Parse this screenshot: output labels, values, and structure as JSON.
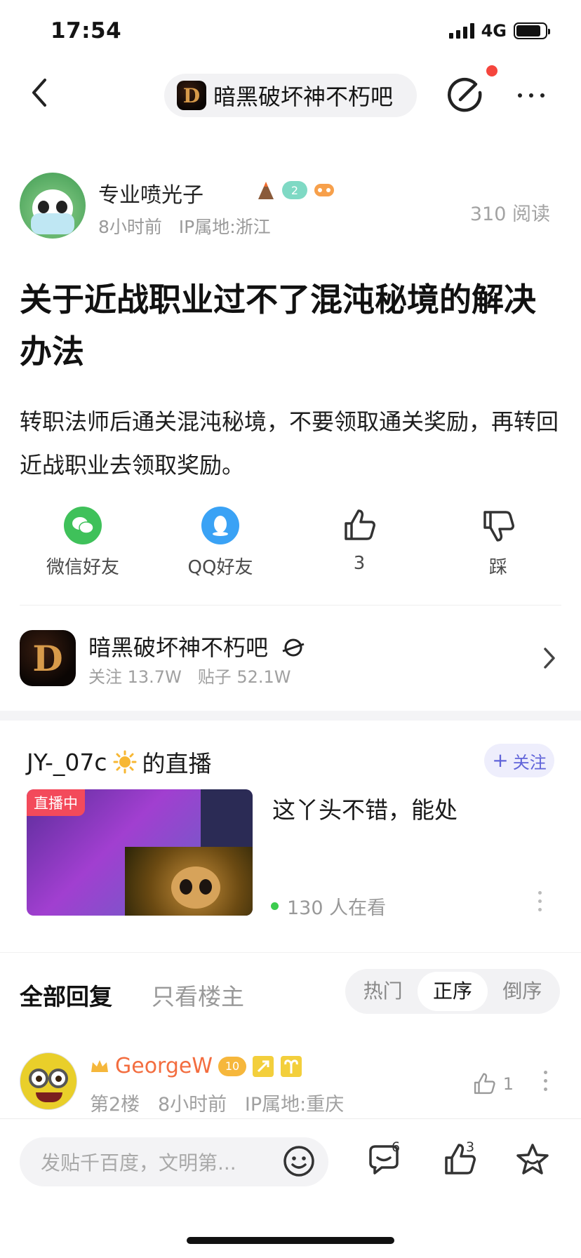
{
  "status_bar": {
    "time": "17:54",
    "network": "4G"
  },
  "nav": {
    "forum_title": "暗黑破坏神不朽吧",
    "logo_letter": "D"
  },
  "post": {
    "author": "专业喷光子",
    "level": "2",
    "time_ago": "8小时前",
    "ip": "IP属地:浙江",
    "views": "310 阅读",
    "title": "关于近战职业过不了混沌秘境的解决办法",
    "body": "转职法师后通关混沌秘境，不要领取通关奖励，再转回近战职业去领取奖励。"
  },
  "actions": {
    "wechat": "微信好友",
    "qq": "QQ好友",
    "like_count": "3",
    "dislike": "踩"
  },
  "forum_card": {
    "name": "暗黑破坏神不朽吧",
    "logo_letter": "D",
    "followers": "关注 13.7W",
    "posts": "贴子 52.1W"
  },
  "live": {
    "streamer": "JY-_07c",
    "suffix": "的直播",
    "follow": "关注",
    "badge": "直播中",
    "description": "这丫头不错，能处",
    "watching": "130 人在看"
  },
  "replies": {
    "tab_all": "全部回复",
    "tab_owner": "只看楼主",
    "sort": [
      {
        "label": "热门",
        "active": false
      },
      {
        "label": "正序",
        "active": true
      },
      {
        "label": "倒序",
        "active": false
      }
    ]
  },
  "comment": {
    "author": "GeorgeW",
    "level": "10",
    "floor": "第2楼",
    "time_ago": "8小时前",
    "ip": "IP属地:重庆",
    "likes": "1"
  },
  "bottom_bar": {
    "placeholder": "发贴千百度，文明第...",
    "reply_count": "6",
    "like_count": "3"
  },
  "colors": {
    "accent": "#6064d9",
    "wechat": "#3fc15a",
    "qq": "#3aa2f5",
    "live_red": "#f34a5b",
    "vip_name": "#f36d3f"
  }
}
